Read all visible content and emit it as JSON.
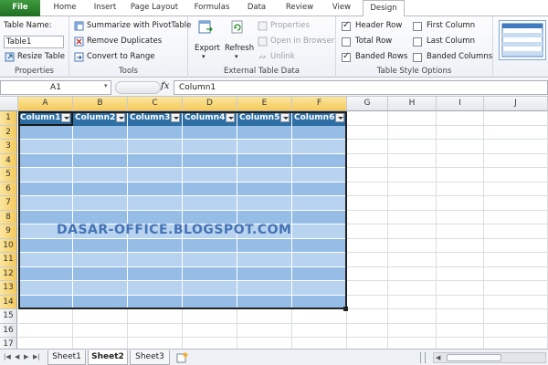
{
  "tabs": [
    "File",
    "Home",
    "Insert",
    "Page Layout",
    "Formulas",
    "Data",
    "Review",
    "View",
    "Design"
  ],
  "ribbon": {
    "properties": {
      "table_name_label": "Table Name:",
      "table_name_value": "Table1",
      "resize_label": "Resize Table",
      "group_label": "Properties"
    },
    "tools": {
      "summarize": "Summarize with PivotTable",
      "remove_dup": "Remove Duplicates",
      "convert": "Convert to Range",
      "group_label": "Tools"
    },
    "external": {
      "export": "Export",
      "refresh": "Refresh",
      "properties": "Properties",
      "open_browser": "Open in Browser",
      "unlink": "Unlink",
      "group_label": "External Table Data"
    },
    "style_options": {
      "header_row": "Header Row",
      "total_row": "Total Row",
      "banded_rows": "Banded Rows",
      "first_column": "First Column",
      "last_column": "Last Column",
      "banded_columns": "Banded Columns",
      "group_label": "Table Style Options"
    }
  },
  "formula_bar": {
    "name_box": "A1",
    "fx": "fx",
    "content": "Column1"
  },
  "columns": [
    "A",
    "B",
    "C",
    "D",
    "E",
    "F",
    "G",
    "H",
    "I",
    "J"
  ],
  "rows": [
    "1",
    "2",
    "3",
    "4",
    "5",
    "6",
    "7",
    "8",
    "9",
    "10",
    "11",
    "12",
    "13",
    "14",
    "15",
    "16",
    "17"
  ],
  "table_headers": [
    "Column1",
    "Column2",
    "Column3",
    "Column4",
    "Column5",
    "Column6"
  ],
  "watermark": "DASAR-OFFICE.BLOGSPOT.COM",
  "sheets": [
    "Sheet1",
    "Sheet2",
    "Sheet3"
  ],
  "colors": {
    "table_header": "#2d6ea5",
    "band_dark": "#95bde6",
    "band_light": "#b8d3ef",
    "accent_file": "#2e7d32"
  }
}
